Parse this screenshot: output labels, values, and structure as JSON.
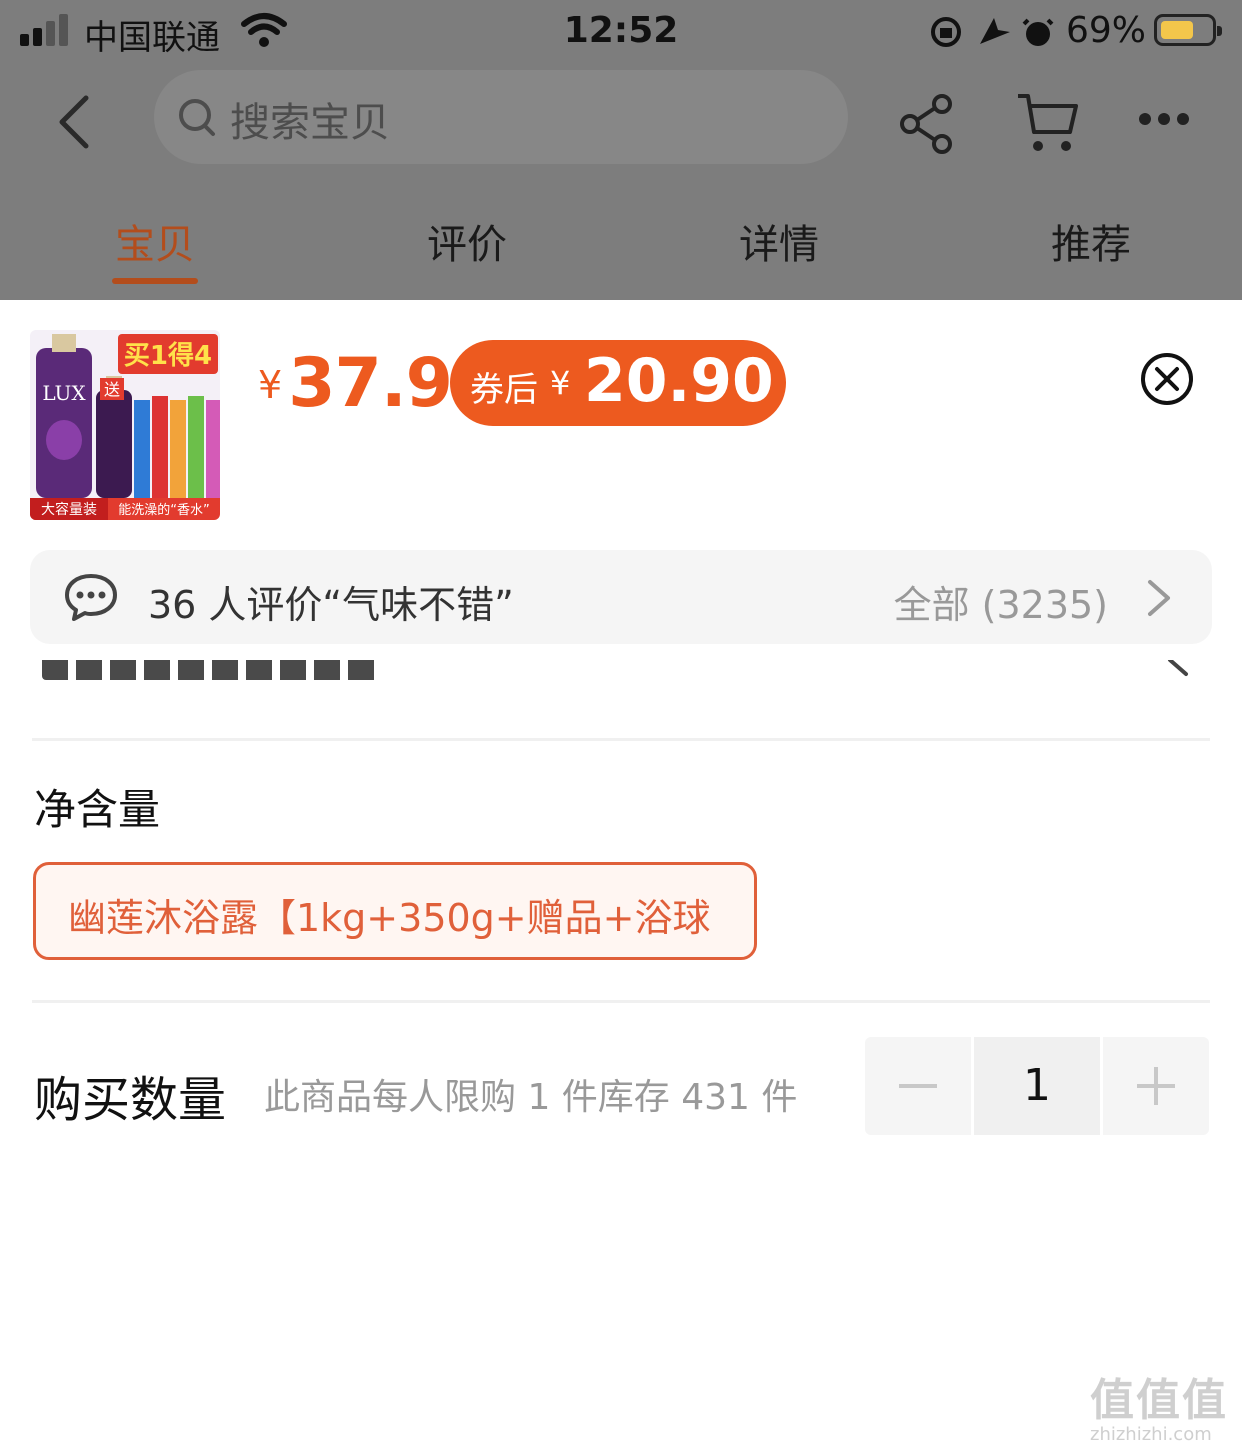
{
  "status_bar": {
    "carrier": "中国联通",
    "time": "12:52",
    "battery": "69%",
    "battery_color": "#f3c64b"
  },
  "header": {
    "search_placeholder": "搜索宝贝",
    "icons": [
      "back-icon",
      "search-icon",
      "share-icon",
      "cart-icon",
      "more-icon"
    ]
  },
  "tabs": [
    {
      "label": "宝贝",
      "active": true
    },
    {
      "label": "评价",
      "active": false
    },
    {
      "label": "详情",
      "active": false
    },
    {
      "label": "推荐",
      "active": false
    }
  ],
  "product": {
    "thumb_badge": "买1得4",
    "thumb_brand": "LUX",
    "thumb_gift": "送",
    "thumb_footer_left": "大容量装",
    "thumb_footer_right": "能洗澡的“香水”",
    "price_symbol": "¥",
    "price": "37.9",
    "coupon_label": "券后",
    "coupon_symbol": "¥",
    "coupon_price": "20.90",
    "accent_color": "#ed5a1f"
  },
  "review_bar": {
    "summary": "36 人评价“气味不错”",
    "all_label": "全部 (3235)"
  },
  "spec": {
    "title": "净含量",
    "selected_option": "幽莲沐浴露【1kg+350g+赠品+浴球"
  },
  "quantity": {
    "label": "购买数量",
    "note": "此商品每人限购 1 件库存 431 件",
    "value": "1",
    "minus": "—",
    "plus": "+"
  },
  "watermark": {
    "text": "值值值",
    "url": "zhizhizhi.com"
  }
}
